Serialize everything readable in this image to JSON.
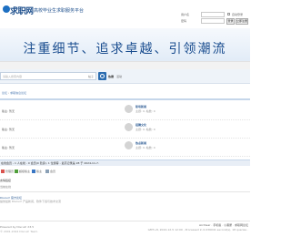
{
  "header": {
    "logo_text": "求职网",
    "slogan": "高校毕业生求职服务平台",
    "login": {
      "username_label": "用户名",
      "password_label": "密码",
      "autologin_label": "自动登录",
      "forgot_label": "找回密码",
      "login_button": "登录",
      "register_button": "立即注册"
    }
  },
  "banner": {
    "title": "注重细节、追求卓越、引领潮流"
  },
  "search": {
    "placeholder": "请输入搜索内容",
    "scope": "帖子",
    "button_label": "搜索",
    "hot_label": "热搜",
    "hot_item": "活动"
  },
  "breadcrumb": {
    "home": "论坛",
    "sep": " › ",
    "current": "求职信息论坛"
  },
  "forums": [
    {
      "left_label": "版主: 暂无",
      "name": "职场新闻",
      "stats": "主题: 0, 帖数: 0"
    },
    {
      "left_label": "版主: 暂无",
      "name": "招聘文化",
      "stats": "主题: 0, 帖数: 0"
    },
    {
      "left_label": "版主: 暂无",
      "name": "热点新闻",
      "stats": "主题: 0, 帖数: 0"
    }
  ],
  "online": {
    "title": "在线会员 - 1 人在线 - 0 会员(0 隐身), 1 位游客 - 最高记录是 28 于 2024-11-7.",
    "legend": [
      "管理员",
      "超级版主",
      "版主",
      "会员"
    ],
    "legend_colors": [
      "#d9534f",
      "#4f9e3a",
      "#3a76c3",
      "#8aa0b6"
    ]
  },
  "links": {
    "title": "友情链接",
    "subtitle": "当前在线"
  },
  "friend": {
    "name": "Discuz! 官方论坛",
    "desc": "提供最新 Discuz! 产品新闻、软件下载与技术交流"
  },
  "footer": {
    "powered": "Powered by Discuz! X3.5",
    "copyright": "© 2001-2024 Discuz! Team.",
    "links": "Archiver · 手机版 · 小黑屋 · 求职网论坛",
    "time": "GMT+8, 2024-12-5 12:00 , Processed in 0.036041 second(s), 18 queries ."
  }
}
